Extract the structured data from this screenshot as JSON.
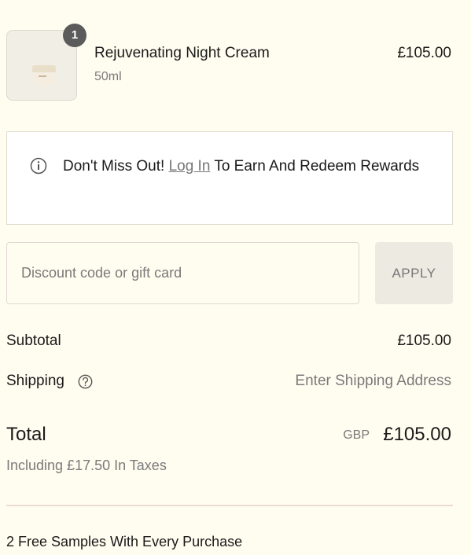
{
  "product": {
    "quantity": "1",
    "name": "Rejuvenating Night Cream",
    "variant": "50ml",
    "price": "£105.00",
    "image_icon": "cream-jar-icon"
  },
  "notice": {
    "icon": "info-icon",
    "text_before": "Don't Miss Out! ",
    "link_text": "Log In",
    "text_after": " To Earn And Redeem Rewards"
  },
  "discount": {
    "placeholder": "Discount code or gift card",
    "value": "",
    "apply_label": "APPLY"
  },
  "summary": {
    "subtotal_label": "Subtotal",
    "subtotal_value": "£105.00",
    "shipping_label": "Shipping",
    "shipping_value": "Enter Shipping Address",
    "total_label": "Total",
    "currency": "GBP",
    "total_value": "£105.00",
    "tax_note": "Including £17.50 In Taxes"
  },
  "footer": {
    "samples_note": "2 Free Samples With Every Purchase"
  },
  "colors": {
    "background": "#fffdf0",
    "badge": "#5b5b5b",
    "muted_text": "#7a7a7a",
    "button_bg": "#edeae2"
  }
}
